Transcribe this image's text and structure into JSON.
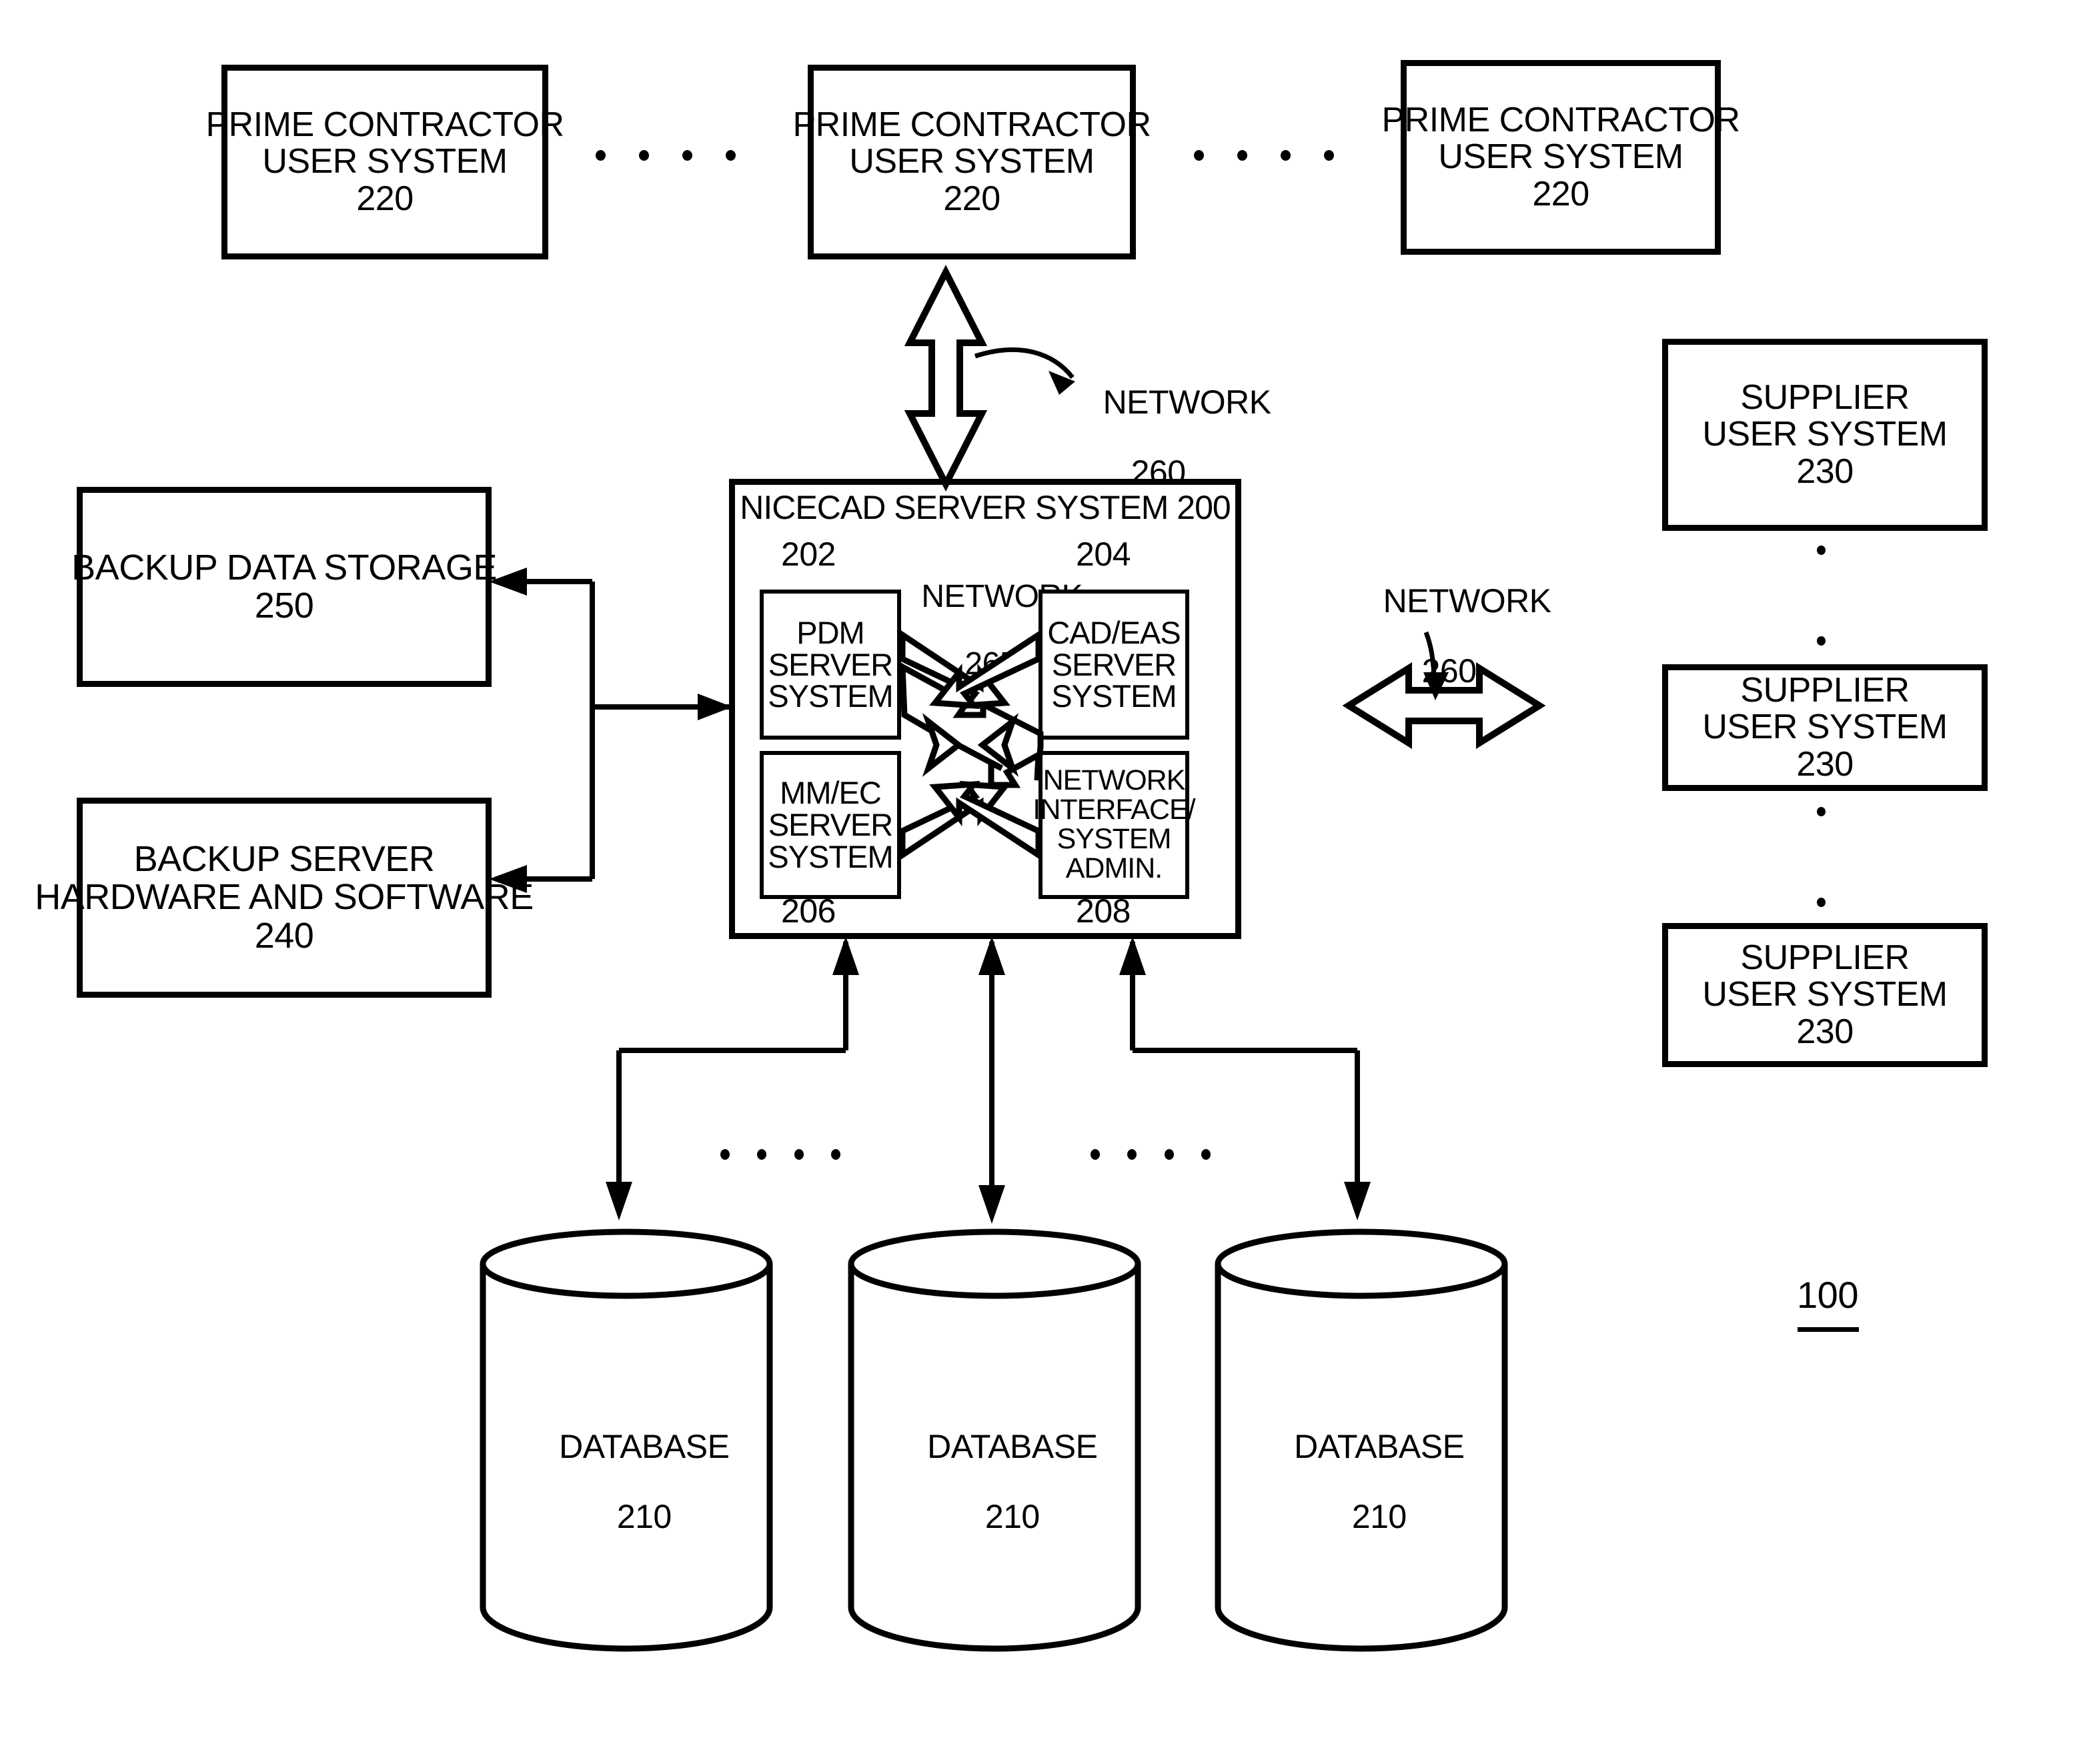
{
  "figure": {
    "reference_numeral": "100",
    "title_boxes": {
      "prime_contractor": {
        "line1": "PRIME CONTRACTOR",
        "line2": "USER SYSTEM",
        "numeral": "220"
      },
      "supplier": {
        "line1": "SUPPLIER",
        "line2": "USER SYSTEM",
        "numeral": "230"
      },
      "backup_storage": {
        "line1": "BACKUP DATA STORAGE",
        "numeral": "250"
      },
      "backup_server": {
        "line1": "BACKUP SERVER",
        "line2": "HARDWARE AND SOFTWARE",
        "numeral": "240"
      },
      "database": {
        "line1": "DATABASE",
        "numeral": "210"
      }
    },
    "server_system": {
      "title": "NICECAD SERVER SYSTEM 200",
      "numeral_top_left": "202",
      "numeral_top_right": "204",
      "numeral_bottom_left": "206",
      "numeral_bottom_right": "208",
      "internal_network": {
        "label": "NETWORK",
        "numeral": "265"
      },
      "modules": {
        "pdm": {
          "line1": "PDM",
          "line2": "SERVER",
          "line3": "SYSTEM"
        },
        "cad_eas": {
          "line1": "CAD/EAS",
          "line2": "SERVER",
          "line3": "SYSTEM"
        },
        "mm_ec": {
          "line1": "MM/EC",
          "line2": "SERVER",
          "line3": "SYSTEM"
        },
        "net_if": {
          "line1": "NETWORK",
          "line2": "INTERFACE/",
          "line3": "SYSTEM",
          "line4": "ADMIN."
        }
      }
    },
    "networks": {
      "top": {
        "label": "NETWORK",
        "numeral": "260"
      },
      "right": {
        "label": "NETWORK",
        "numeral": "260"
      }
    },
    "prime_contractors": [
      {
        "line1": "PRIME CONTRACTOR",
        "line2": "USER SYSTEM",
        "numeral": "220"
      },
      {
        "line1": "PRIME CONTRACTOR",
        "line2": "USER SYSTEM",
        "numeral": "220"
      },
      {
        "line1": "PRIME CONTRACTOR",
        "line2": "USER SYSTEM",
        "numeral": "220"
      }
    ],
    "suppliers": [
      {
        "line1": "SUPPLIER",
        "line2": "USER SYSTEM",
        "numeral": "230"
      },
      {
        "line1": "SUPPLIER",
        "line2": "USER SYSTEM",
        "numeral": "230"
      },
      {
        "line1": "SUPPLIER",
        "line2": "USER SYSTEM",
        "numeral": "230"
      }
    ],
    "databases": [
      {
        "line1": "DATABASE",
        "numeral": "210"
      },
      {
        "line1": "DATABASE",
        "numeral": "210"
      },
      {
        "line1": "DATABASE",
        "numeral": "210"
      }
    ],
    "colors": {
      "ink": "#000000",
      "paper": "#ffffff"
    }
  }
}
